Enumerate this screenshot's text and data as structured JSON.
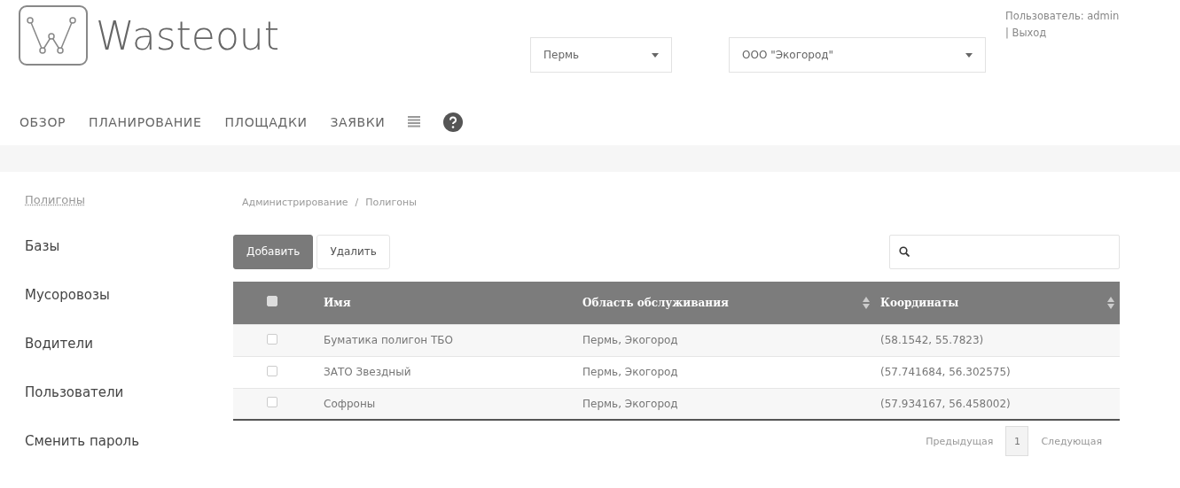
{
  "header": {
    "brand": "Wasteout",
    "city_select": {
      "value": "Пермь"
    },
    "company_select": {
      "value": "ООО \"Экогород\""
    },
    "user": {
      "label": "Пользователь: admin",
      "logout": "| Выход"
    }
  },
  "nav": [
    {
      "label": "ОБЗОР"
    },
    {
      "label": "ПЛАНИРОВАНИЕ"
    },
    {
      "label": "ПЛОЩАДКИ"
    },
    {
      "label": "ЗАЯВКИ"
    }
  ],
  "sidebar": {
    "items": [
      {
        "label": "Полигоны",
        "selected": true
      },
      {
        "label": "Базы",
        "selected": false
      },
      {
        "label": "Мусоровозы",
        "selected": false
      },
      {
        "label": "Водители",
        "selected": false
      },
      {
        "label": "Пользователи",
        "selected": false
      },
      {
        "label": "Сменить пароль",
        "selected": false
      }
    ]
  },
  "breadcrumb": [
    "Администрирование",
    "Полигоны"
  ],
  "breadcrumb_separator": "/",
  "buttons": [
    {
      "label": "Добавить",
      "kind": "primary"
    },
    {
      "label": "Удалить",
      "kind": "default"
    }
  ],
  "table": {
    "select_all_checked": false,
    "columns": [
      {
        "label": "Имя",
        "sortable": false
      },
      {
        "label": "Область обслуживания",
        "sortable": true
      },
      {
        "label": "Координаты",
        "sortable": true
      }
    ],
    "rows": [
      {
        "checked": false,
        "cells": [
          "Буматика полигон ТБО",
          "Пермь, Экогород",
          "(58.1542, 55.7823)"
        ]
      },
      {
        "checked": false,
        "cells": [
          "ЗАТО Звездный",
          "Пермь, Экогород",
          "(57.741684, 56.302575)"
        ]
      },
      {
        "checked": false,
        "cells": [
          "Софроны",
          "Пермь, Экогород",
          "(57.934167, 56.458002)"
        ]
      }
    ]
  },
  "pagination": {
    "previous": "Предыдущая",
    "pages": [
      {
        "label": "1",
        "selected": true
      }
    ],
    "next": "Следующая"
  }
}
